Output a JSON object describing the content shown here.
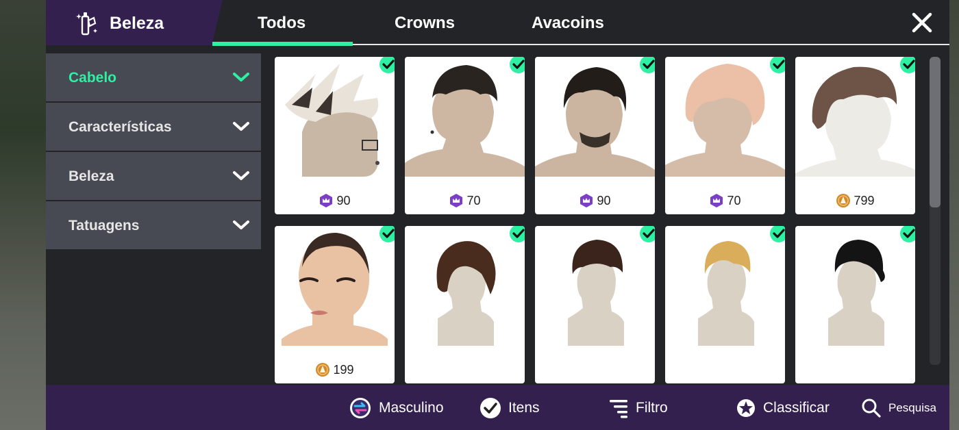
{
  "header": {
    "title": "Beleza",
    "title_icon": "beauty-brush-icon",
    "tabs": [
      {
        "label": "Todos",
        "active": true
      },
      {
        "label": "Crowns",
        "active": false
      },
      {
        "label": "Avacoins",
        "active": false
      }
    ],
    "close_icon": "close-icon"
  },
  "sidebar": {
    "items": [
      {
        "label": "Cabelo",
        "active": true
      },
      {
        "label": "Características",
        "active": false
      },
      {
        "label": "Beleza",
        "active": false
      },
      {
        "label": "Tatuagens",
        "active": false
      }
    ]
  },
  "items": [
    {
      "price": "90",
      "currency": "crowns",
      "owned": true
    },
    {
      "price": "70",
      "currency": "crowns",
      "owned": true
    },
    {
      "price": "90",
      "currency": "crowns",
      "owned": true
    },
    {
      "price": "70",
      "currency": "crowns",
      "owned": true
    },
    {
      "price": "799",
      "currency": "avacoins",
      "owned": true
    },
    {
      "price": "199",
      "currency": "avacoins",
      "owned": true
    },
    {
      "price": "",
      "currency": "",
      "owned": true
    },
    {
      "price": "",
      "currency": "",
      "owned": true
    },
    {
      "price": "",
      "currency": "",
      "owned": true
    },
    {
      "price": "",
      "currency": "",
      "owned": true
    }
  ],
  "bottombar": {
    "gender_label": "Masculino",
    "items_label": "Itens",
    "filter_label": "Filtro",
    "sort_label": "Classificar",
    "search_label": "Pesquisa"
  },
  "colors": {
    "accent": "#2ef0a3",
    "purple": "#33204f",
    "panel": "#232427",
    "sidebar_item": "#474a52",
    "crown_badge": "#7b3fc7",
    "avacoin": "#d08a2a"
  }
}
